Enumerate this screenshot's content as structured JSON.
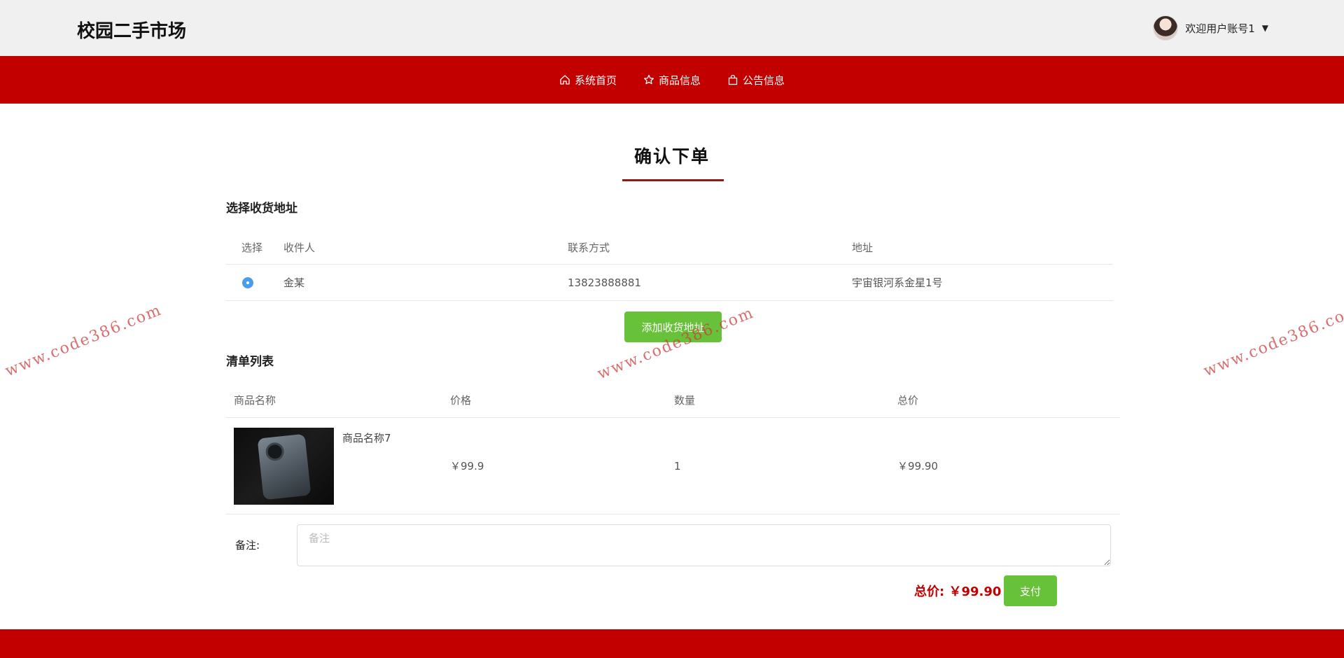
{
  "header": {
    "brand": "校园二手市场",
    "welcome": "欢迎用户账号1",
    "caret": "▼"
  },
  "nav": {
    "items": [
      {
        "label": "系统首页",
        "icon": "home-icon"
      },
      {
        "label": "商品信息",
        "icon": "star-icon"
      },
      {
        "label": "公告信息",
        "icon": "bag-icon"
      }
    ]
  },
  "page": {
    "title": "确认下单"
  },
  "address": {
    "section_title": "选择收货地址",
    "columns": [
      "选择",
      "收件人",
      "联系方式",
      "地址"
    ],
    "rows": [
      {
        "name": "金某",
        "phone": "13823888881",
        "address": "宇宙银河系金星1号",
        "selected": true
      }
    ],
    "add_button": "添加收货地址"
  },
  "cart": {
    "section_title": "清单列表",
    "columns": [
      "商品名称",
      "价格",
      "数量",
      "总价"
    ],
    "rows": [
      {
        "name": "商品名称7",
        "price": "￥99.9",
        "qty": "1",
        "total": "￥99.90"
      }
    ]
  },
  "remark": {
    "label": "备注:",
    "placeholder": "备注"
  },
  "summary": {
    "total_text": "总价: ￥99.90",
    "pay_button": "支付"
  },
  "watermark": "www.code386.com",
  "colors": {
    "brand_red": "#c30000",
    "button_green": "#67c23a",
    "radio_blue": "#4a9de8",
    "title_underline": "#8b1a1a"
  }
}
